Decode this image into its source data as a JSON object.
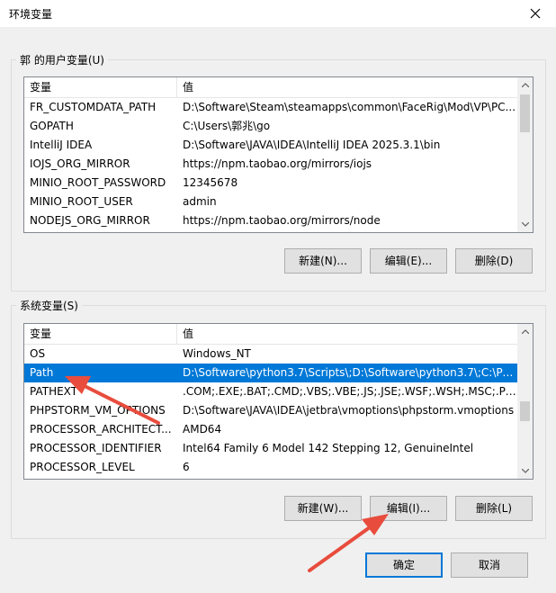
{
  "window": {
    "title": "环境变量"
  },
  "user_vars": {
    "group_label": "郭 的用户变量(U)",
    "columns": [
      "变量",
      "值"
    ],
    "rows": [
      {
        "name": "FR_CUSTOMDATA_PATH",
        "value": "D:\\Software\\Steam\\steamapps\\common\\FaceRig\\Mod\\VP\\PC..."
      },
      {
        "name": "GOPATH",
        "value": "C:\\Users\\郭兆\\go"
      },
      {
        "name": "IntelliJ IDEA",
        "value": "D:\\Software\\JAVA\\IDEA\\IntelliJ IDEA 2025.3.1\\bin"
      },
      {
        "name": "IOJS_ORG_MIRROR",
        "value": "https://npm.taobao.org/mirrors/iojs"
      },
      {
        "name": "MINIO_ROOT_PASSWORD",
        "value": "12345678"
      },
      {
        "name": "MINIO_ROOT_USER",
        "value": "admin"
      },
      {
        "name": "NODEJS_ORG_MIRROR",
        "value": "https://npm.taobao.org/mirrors/node"
      }
    ],
    "buttons": {
      "new": "新建(N)...",
      "edit": "编辑(E)...",
      "delete": "删除(D)"
    }
  },
  "system_vars": {
    "group_label": "系统变量(S)",
    "columns": [
      "变量",
      "值"
    ],
    "rows": [
      {
        "name": "OS",
        "value": "Windows_NT"
      },
      {
        "name": "Path",
        "value": "D:\\Software\\python3.7\\Scripts\\;D:\\Software\\python3.7\\;C:\\Pro..."
      },
      {
        "name": "PATHEXT",
        "value": ".COM;.EXE;.BAT;.CMD;.VBS;.VBE;.JS;.JSE;.WSF;.WSH;.MSC;.PY;.P..."
      },
      {
        "name": "PHPSTORM_VM_OPTIONS",
        "value": "D:\\Software\\JAVA\\IDEA\\jetbra\\vmoptions\\phpstorm.vmoptions"
      },
      {
        "name": "PROCESSOR_ARCHITECT...",
        "value": "AMD64"
      },
      {
        "name": "PROCESSOR_IDENTIFIER",
        "value": "Intel64 Family 6 Model 142 Stepping 12, GenuineIntel"
      },
      {
        "name": "PROCESSOR_LEVEL",
        "value": "6"
      }
    ],
    "selected_index": 1,
    "buttons": {
      "new": "新建(W)...",
      "edit": "编辑(I)...",
      "delete": "删除(L)"
    }
  },
  "footer": {
    "ok": "确定",
    "cancel": "取消"
  },
  "colors": {
    "selection": "#0078d7",
    "annotation_arrow": "#e84c3d"
  }
}
